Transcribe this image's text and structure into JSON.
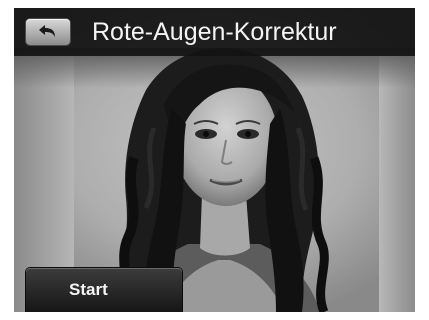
{
  "header": {
    "title": "Rote-Augen-Korrektur",
    "back_icon": "back-arrow-icon"
  },
  "controls": {
    "start_label": "Start"
  },
  "preview": {
    "image": "grayscale portrait photo of a woman with long dark wavy hair",
    "style": "grayscale"
  },
  "colors": {
    "title_bar": "#121212",
    "text": "#f4f4f4",
    "button_dark": "#1a1a1a",
    "button_light": "#c8c8c8"
  }
}
